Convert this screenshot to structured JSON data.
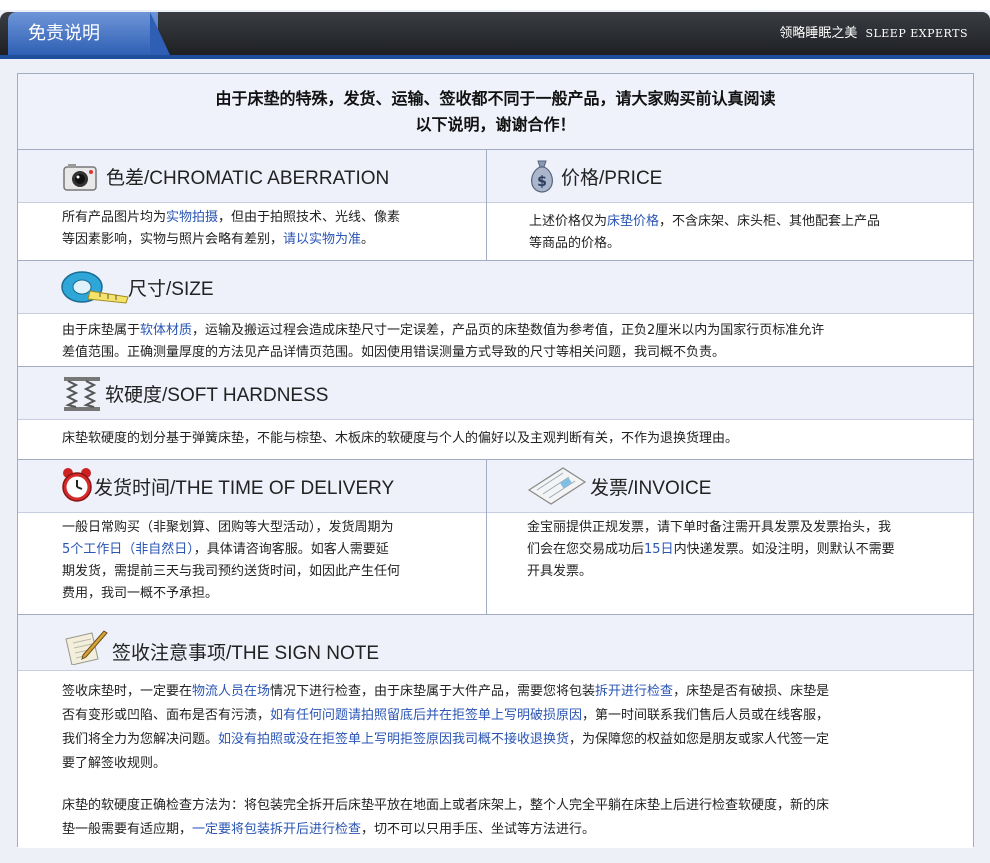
{
  "header": {
    "tab_title": "免责说明",
    "slogan_cn": "领略睡眠之美",
    "slogan_en": "SLEEP EXPERTS"
  },
  "intro": {
    "line1": "由于床垫的特殊，发货、运输、签收都不同于一般产品，请大家购买前认真阅读",
    "line2": "以下说明，谢谢合作！"
  },
  "chromatic": {
    "title": "色差/CHROMATIC ABERRATION",
    "icon": "camera-icon",
    "p1_a": "所有产品图片均为",
    "p1_hl": "实物拍摄",
    "p1_b": "，但由于拍照技术、光线、像素",
    "p2_a": "等因素影响，实物与照片会略有差别，",
    "p2_hl": "请以实物为准",
    "p2_b": "。"
  },
  "price": {
    "title": "价格/PRICE",
    "icon": "money-bag-icon",
    "p1_a": "上述价格仅为",
    "p1_hl": "床垫价格",
    "p1_b": "，不含床架、床头柜、其他配套上产品",
    "p2": "等商品的价格。"
  },
  "size": {
    "title": "尺寸/SIZE",
    "icon": "tape-measure-icon",
    "p1_a": "由于床垫属于",
    "p1_hl": "软体材质",
    "p1_b": "，运输及搬运过程会造成床垫尺寸一定误差，产品页的床垫数值为参考值，正负2厘米以内为国家行页标准允许",
    "p2": "差值范围。正确测量厚度的方法见产品详情页范围。如因使用错误测量方式导致的尺寸等相关问题，我司概不负责。"
  },
  "hardness": {
    "title": "软硬度/SOFT HARDNESS",
    "icon": "spring-icon",
    "p1": "床垫软硬度的划分基于弹簧床垫，不能与棕垫、木板床的软硬度与个人的偏好以及主观判断有关，不作为退换货理由。"
  },
  "delivery": {
    "title": "发货时间/THE TIME OF DELIVERY",
    "icon": "alarm-clock-icon",
    "p1": "一般日常购买（非聚划算、团购等大型活动），发货周期为",
    "p2_hl": "5个工作日（非自然日）",
    "p2_b": "，具体请咨询客服。如客人需要延",
    "p3": "期发货，需提前三天与我司预约送货时间，如因此产生任何",
    "p4": "费用，我司一概不予承担。"
  },
  "invoice": {
    "title": "发票/INVOICE",
    "icon": "invoice-icon",
    "p1": "金宝丽提供正规发票，请下单时备注需开具发票及发票抬头，我",
    "p2_a": "们会在您交易成功后",
    "p2_hl": "15日",
    "p2_b": "内快递发票。如没注明，则默认不需要",
    "p3": "开具发票。"
  },
  "sign": {
    "title": "签收注意事项/THE SIGN NOTE",
    "icon": "document-pen-icon",
    "p1_a": "签收床垫时，一定要在",
    "p1_hl1": "物流人员在场",
    "p1_b": "情况下进行检查，由于床垫属于大件产品，需要您将包装",
    "p1_hl2": "拆开进行检查",
    "p1_c": "，床垫是否有破损、床垫是",
    "p2_a": "否有变形或凹陷、面布是否有污渍，",
    "p2_hl": "如有任何问题请拍照留底后并在拒签单上写明破损原因",
    "p2_b": "，第一时间联系我们售后人员或在线客服，",
    "p3_a": "我们将全力为您解决问题。",
    "p3_hl": "如没有拍照或没在拒签单上写明拒签原因我司概不接收退换货",
    "p3_b": "，为保障您的权益如您是朋友或家人代签一定",
    "p4": "要了解签收规则。",
    "p5": "床垫的软硬度正确检查方法为：将包装完全拆开后床垫平放在地面上或者床架上，整个人完全平躺在床垫上后进行检查软硬度，新的床",
    "p6_a": "垫一般需要有适应期，",
    "p6_hl": "一定要将包装拆开后进行检查",
    "p6_b": "，切不可以只用手压、坐试等方法进行。"
  }
}
